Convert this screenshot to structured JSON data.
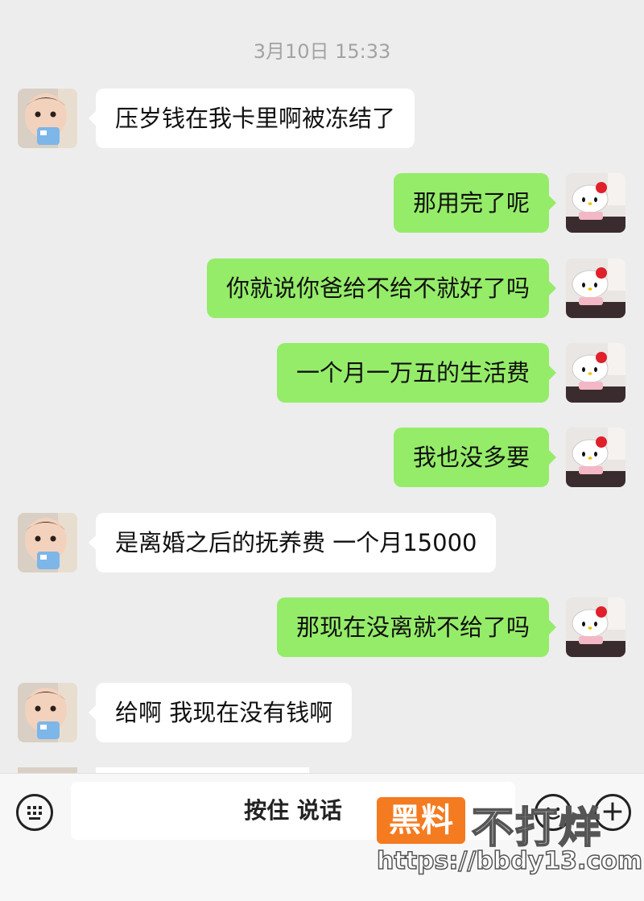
{
  "chat": {
    "timestamp": "3月10日 15:33",
    "messages": [
      {
        "side": "incoming",
        "text": "压岁钱在我卡里啊被冻结了"
      },
      {
        "side": "outgoing",
        "text": "那用完了呢"
      },
      {
        "side": "outgoing",
        "text": "你就说你爸给不给不就好了吗"
      },
      {
        "side": "outgoing",
        "text": "一个月一万五的生活费"
      },
      {
        "side": "outgoing",
        "text": "我也没多要"
      },
      {
        "side": "incoming",
        "text": "是离婚之后的抚养费 一个月15000"
      },
      {
        "side": "outgoing",
        "text": "那现在没离就不给了吗"
      },
      {
        "side": "incoming",
        "text": "给啊 我现在没有钱啊"
      }
    ]
  },
  "input_bar": {
    "voice_label": "按住 说话",
    "keyboard_icon": "keyboard-icon",
    "emoji_icon": "emoji-icon",
    "plus_icon": "plus-icon",
    "plus_glyph": "+"
  },
  "watermark": {
    "tag": "黑料",
    "text": "不打烊",
    "url": "https://bbdy13.com"
  },
  "colors": {
    "background": "#ededed",
    "outgoing_bubble": "#95ec69",
    "incoming_bubble": "#ffffff",
    "timestamp": "#a3a3a3",
    "watermark_tag": "#f47b20"
  }
}
